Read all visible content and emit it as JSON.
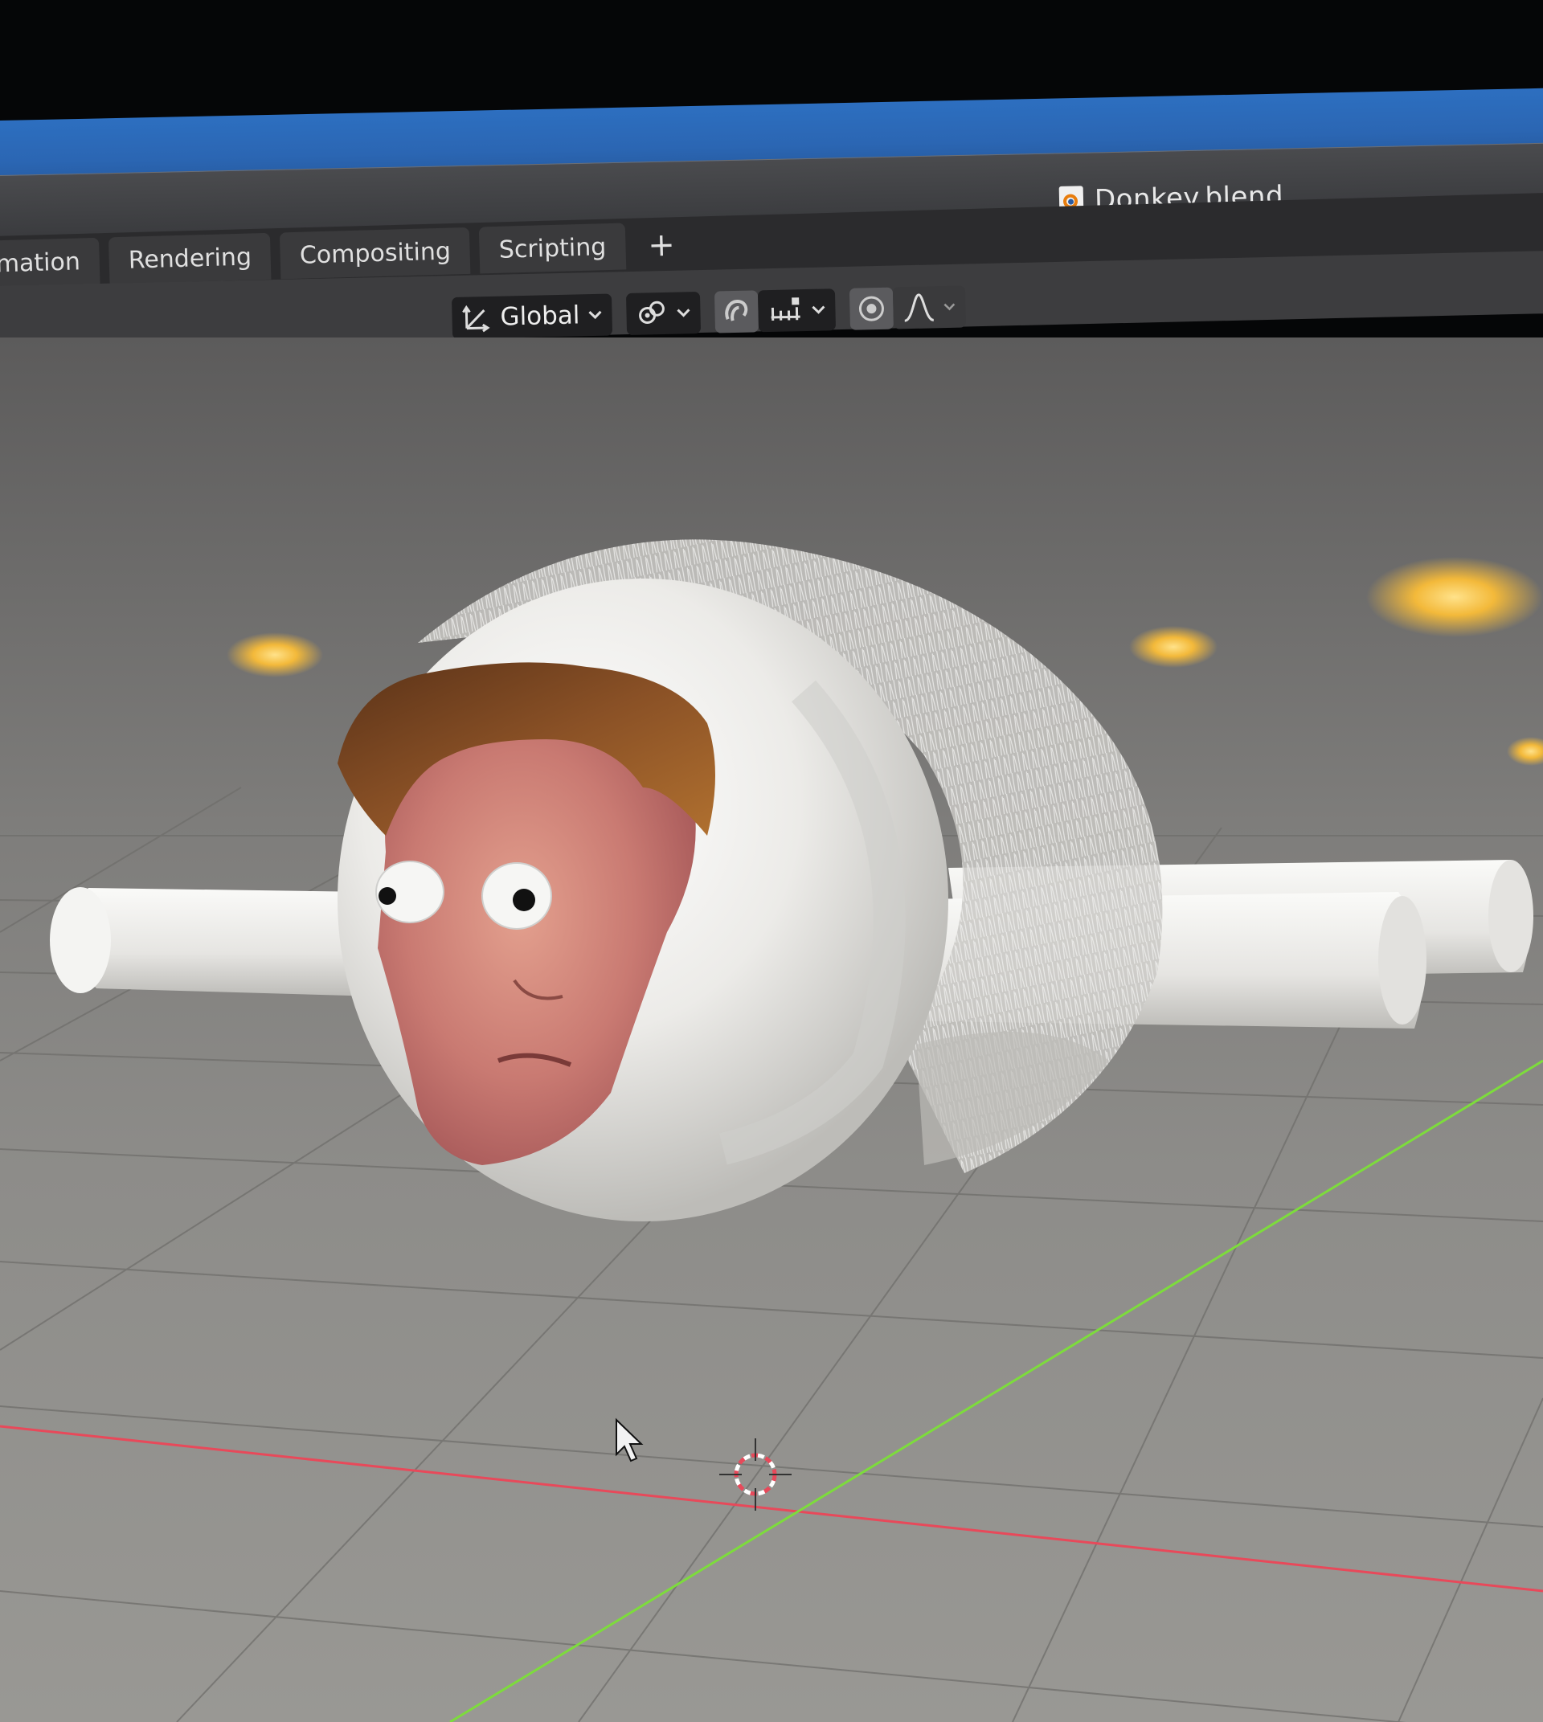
{
  "window": {
    "file_name": "Donkey.blend"
  },
  "workspace_tabs": [
    {
      "label": "mation"
    },
    {
      "label": "Rendering"
    },
    {
      "label": "Compositing"
    },
    {
      "label": "Scripting"
    },
    {
      "label": "+"
    }
  ],
  "viewport_header": {
    "transform_orientation": "Global",
    "icons": [
      "transform-gizmo-icon",
      "pivot-link-icon",
      "snap-magnet-icon",
      "snap-increment-icon",
      "proportional-edit-icon",
      "falloff-curve-icon"
    ]
  },
  "scene": {
    "objects": [
      "fur-covered-sphere",
      "photo-face-plane",
      "googly-eyes",
      "wing-cylinders",
      "point-lights"
    ],
    "axis_colors": {
      "x": "#e8495a",
      "y": "#7ddc3c"
    },
    "icons": [
      "mouse-cursor-icon",
      "3d-cursor-icon"
    ]
  },
  "colors": {
    "titlebar": "#3a3b3e",
    "workspace_bar": "#2b2b2d",
    "tab": "#3a3a3c",
    "accent_blue": "#2b66b3",
    "light": "#f3b93a"
  }
}
